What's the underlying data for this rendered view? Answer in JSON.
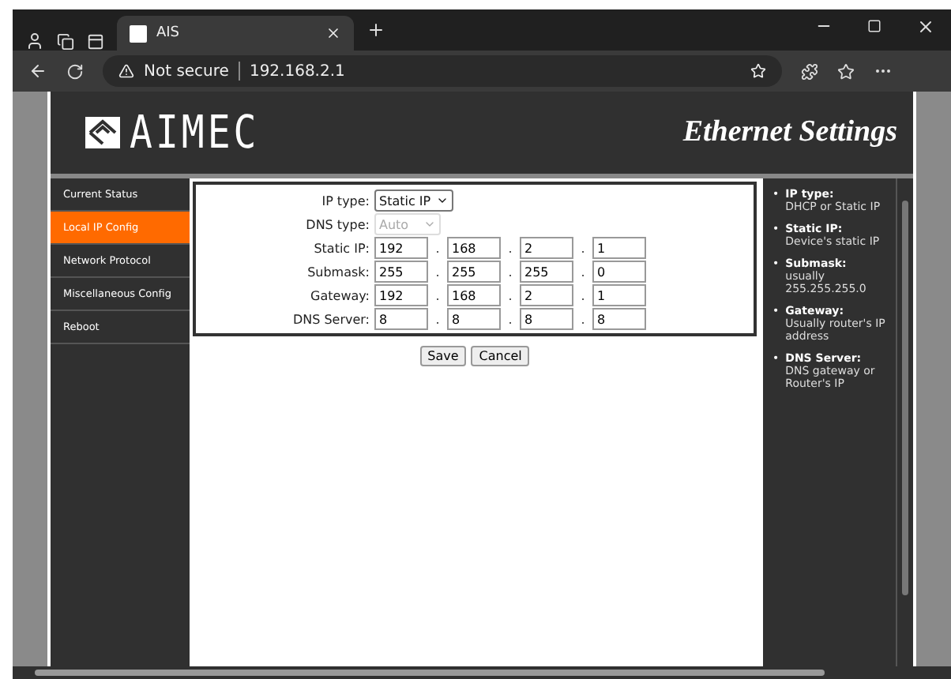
{
  "browser": {
    "tabs": [
      {
        "title": "AIS",
        "selected": true
      }
    ],
    "address": {
      "security": "Not secure",
      "url": "192.168.2.1"
    }
  },
  "page": {
    "logo": "AIMEC",
    "title": "Ethernet Settings",
    "nav": [
      {
        "label": "Current Status",
        "selected": false
      },
      {
        "label": "Local IP Config",
        "selected": true
      },
      {
        "label": "Network Protocol",
        "selected": false
      },
      {
        "label": "Miscellaneous Config",
        "selected": false
      },
      {
        "label": "Reboot",
        "selected": false
      }
    ],
    "form": {
      "separator": ".",
      "fields": [
        {
          "label": "IP type:",
          "kind": "select",
          "value": "Static IP",
          "disabled": false
        },
        {
          "label": "DNS type:",
          "kind": "select",
          "value": "Auto",
          "disabled": true
        },
        {
          "label": "Static IP:",
          "kind": "ip",
          "octets": [
            "192",
            "168",
            "2",
            "1"
          ]
        },
        {
          "label": "Submask:",
          "kind": "ip",
          "octets": [
            "255",
            "255",
            "255",
            "0"
          ]
        },
        {
          "label": "Gateway:",
          "kind": "ip",
          "octets": [
            "192",
            "168",
            "2",
            "1"
          ]
        },
        {
          "label": "DNS Server:",
          "kind": "ip",
          "octets": [
            "8",
            "8",
            "8",
            "8"
          ]
        }
      ]
    },
    "buttons": [
      "Save",
      "Cancel"
    ],
    "help_bullet": "•",
    "help": [
      {
        "term": "IP type:",
        "desc": "DHCP or Static IP"
      },
      {
        "term": "Static IP:",
        "desc": "Device's static IP"
      },
      {
        "term": "Submask:",
        "desc": "usually 255.255.255.0"
      },
      {
        "term": "Gateway:",
        "desc": "Usually router's IP address"
      },
      {
        "term": "DNS Server:",
        "desc": "DNS gateway or Router's IP"
      }
    ]
  }
}
